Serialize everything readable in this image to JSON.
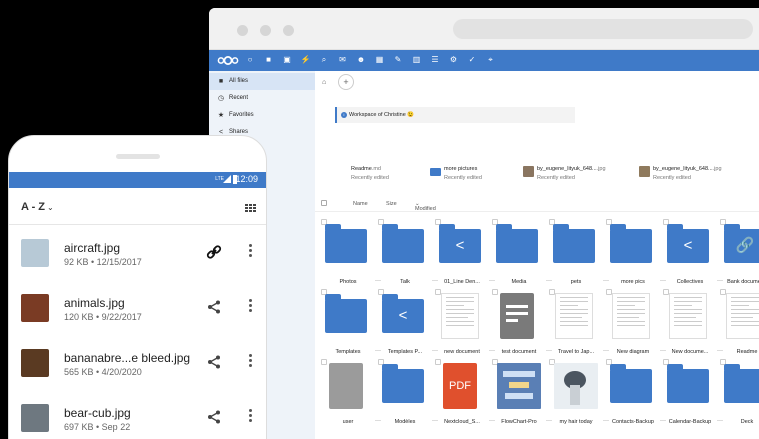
{
  "colors": {
    "brand": "#3f7ac8",
    "sidebar": "#eef3f9",
    "sidebar_active": "#d7e4f5",
    "background": "#000000"
  },
  "desktop": {
    "header_icons": [
      "nextcloud-logo-icon",
      "dashboard-icon",
      "files-icon",
      "photos-icon",
      "activity-icon",
      "search-icon",
      "mail-icon",
      "contacts-icon",
      "calendar-icon",
      "notes-icon",
      "deck-icon",
      "tasks-icon",
      "settings-icon",
      "checkmark-icon",
      "maps-icon"
    ],
    "sidebar": {
      "items": [
        {
          "label": "All files",
          "icon": "folder-icon",
          "active": true
        },
        {
          "label": "Recent",
          "icon": "clock-icon",
          "active": false
        },
        {
          "label": "Favorites",
          "icon": "star-icon",
          "active": false
        },
        {
          "label": "Shares",
          "icon": "share-icon",
          "active": false
        }
      ]
    },
    "breadcrumb": {
      "home_icon": "home-icon",
      "add": "+"
    },
    "workspace": {
      "text": "Workspace of Christine 😉"
    },
    "recent_files": [
      {
        "name": "Readme",
        "ext": ".md",
        "sub": "Recently edited"
      },
      {
        "name": "more pictures",
        "ext": "",
        "sub": "Recently edited"
      },
      {
        "name": "by_eugene_lityuk_648...",
        "ext": ".jpg",
        "sub": "Recently edited"
      },
      {
        "name": "by_eugene_lityuk_648...",
        "ext": ".jpg",
        "sub": "Recently edited"
      }
    ],
    "columns": {
      "name": "Name",
      "size": "Size",
      "modified": "Modified"
    },
    "tiles": [
      {
        "label": "Photos",
        "kind": "folder",
        "symbol": ""
      },
      {
        "label": "Talk",
        "kind": "folder",
        "symbol": ""
      },
      {
        "label": "01_Line Den...",
        "kind": "folder",
        "symbol": "share"
      },
      {
        "label": "Media",
        "kind": "folder",
        "symbol": ""
      },
      {
        "label": "pets",
        "kind": "folder",
        "symbol": ""
      },
      {
        "label": "more pics",
        "kind": "folder",
        "symbol": ""
      },
      {
        "label": "Collectives",
        "kind": "folder",
        "symbol": "share"
      },
      {
        "label": "Bank documer...",
        "kind": "folder",
        "symbol": "link"
      },
      {
        "label": "Templates",
        "kind": "folder",
        "symbol": ""
      },
      {
        "label": "Templates P...",
        "kind": "folder",
        "symbol": "share"
      },
      {
        "label": "new document",
        "kind": "doc",
        "symbol": ""
      },
      {
        "label": "test document",
        "kind": "gray-doc",
        "symbol": ""
      },
      {
        "label": "Travel to Jap...",
        "kind": "doc",
        "symbol": ""
      },
      {
        "label": "New diagram",
        "kind": "doc",
        "symbol": ""
      },
      {
        "label": "New docume...",
        "kind": "doc",
        "symbol": ""
      },
      {
        "label": "Readme",
        "kind": "doc",
        "symbol": ""
      },
      {
        "label": "user",
        "kind": "gray-file",
        "symbol": ""
      },
      {
        "label": "Modèles",
        "kind": "folder",
        "symbol": ""
      },
      {
        "label": "Nextcloud_S...",
        "kind": "pdf",
        "symbol": "PDF"
      },
      {
        "label": "FlowChart-Pro",
        "kind": "chart",
        "symbol": ""
      },
      {
        "label": "my hair today",
        "kind": "photo",
        "symbol": ""
      },
      {
        "label": "Contacts-Backup",
        "kind": "folder",
        "symbol": ""
      },
      {
        "label": "Calendar-Backup",
        "kind": "folder",
        "symbol": ""
      },
      {
        "label": "Deck",
        "kind": "folder",
        "symbol": ""
      }
    ]
  },
  "phone": {
    "status": {
      "network": "LTE",
      "time": "12:09"
    },
    "sort_label": "A - Z",
    "sort_icon": "chevron-down-icon",
    "view_icon": "grid-view-icon",
    "files": [
      {
        "name": "aircraft.jpg",
        "meta": "92 KB • 12/15/2017",
        "action_icon": "link-icon",
        "action": "🔗",
        "thumb": "#b7c9d6"
      },
      {
        "name": "animals.jpg",
        "meta": "120 KB • 9/22/2017",
        "action_icon": "share-icon",
        "action": "<",
        "thumb": "#7a3b24"
      },
      {
        "name": "bananabre...e bleed.jpg",
        "meta": "565 KB • 4/20/2020",
        "action_icon": "share-icon",
        "action": "<",
        "thumb": "#5a3a22"
      },
      {
        "name": "bear-cub.jpg",
        "meta": "697 KB • Sep 22",
        "action_icon": "share-icon",
        "action": "<",
        "thumb": "#6e7880"
      }
    ]
  }
}
